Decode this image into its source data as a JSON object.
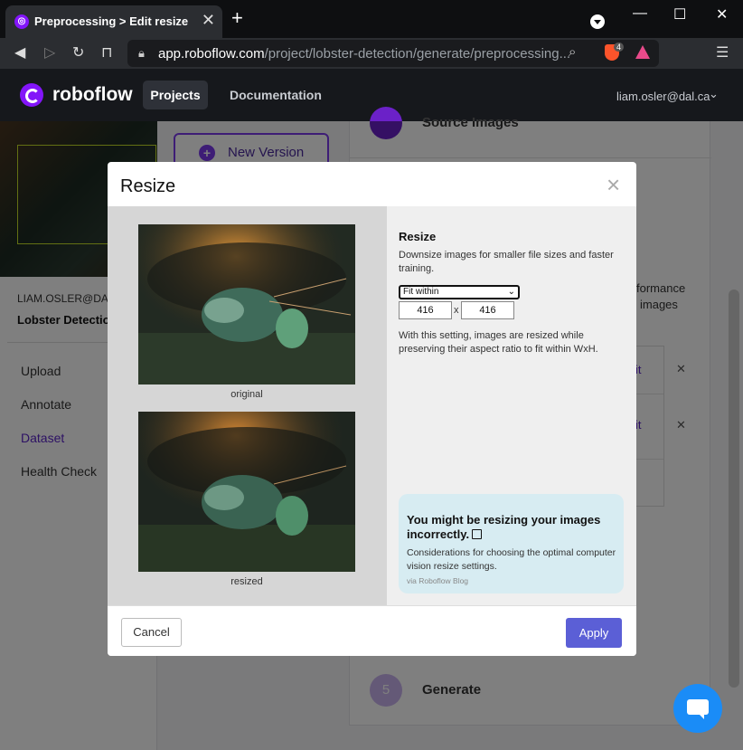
{
  "browser": {
    "tab_title": "Preprocessing > Edit resize",
    "tab_close": "✕",
    "new_tab": "+",
    "url_host": "app.roboflow.com",
    "url_path": "/project/lobster-detection/generate/preprocessing...",
    "brave_badge": "4",
    "minimize": "—",
    "maximize": "☐",
    "close": "✕"
  },
  "header": {
    "logo": "roboflow",
    "nav_projects": "Projects",
    "nav_docs": "Documentation",
    "user_email": "liam.osler@dal.ca"
  },
  "sidebar": {
    "owner": "LIAM.OSLER@DAL.C",
    "project": "Lobster Detection",
    "items": [
      {
        "label": "Upload"
      },
      {
        "label": "Annotate"
      },
      {
        "label": "Dataset"
      },
      {
        "label": "Health Check"
      }
    ]
  },
  "main": {
    "new_version": "New Version",
    "step_source": "Source Images",
    "step5_num": "5",
    "step5_label": "Generate",
    "partial_text_1": "formance",
    "partial_text_2": "images",
    "partial_edit_1": "it",
    "partial_edit_2": "it"
  },
  "modal": {
    "title": "Resize",
    "close": "×",
    "caption_original": "original",
    "caption_resized": "resized",
    "section_title": "Resize",
    "description": "Downsize images for smaller file sizes and faster training.",
    "mode_selected": "Fit within",
    "width": "416",
    "height": "416",
    "times": "x",
    "note": "With this setting, images are resized while preserving their aspect ratio to fit within WxH.",
    "blog": {
      "title": "You might be resizing your images incorrectly.",
      "description": "Considerations for choosing the optimal computer vision resize settings.",
      "via": "via Roboflow Blog"
    },
    "cancel_label": "Cancel",
    "apply_label": "Apply"
  },
  "colors": {
    "accent": "#8315f9",
    "apply": "#5b5fd6",
    "blog_card": "#d7ecf2",
    "chat": "#1a8cf7"
  }
}
